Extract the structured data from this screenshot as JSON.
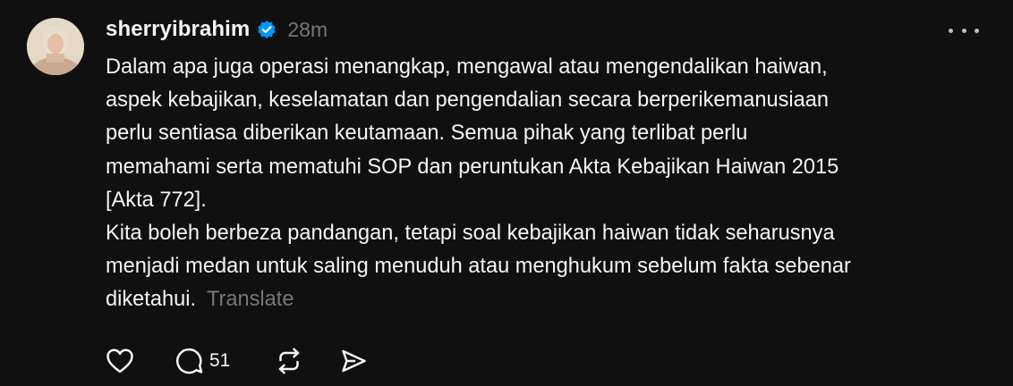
{
  "post": {
    "author": {
      "username": "sherryibrahim",
      "verified": true,
      "avatar_icon": "profile-photo"
    },
    "timestamp": "28m",
    "paragraphs": [
      "Dalam apa juga operasi menangkap, mengawal atau mengendalikan haiwan,\naspek kebajikan, keselamatan dan pengendalian secara berperikemanusiaan\nperlu sentiasa diberikan keutamaan. Semua pihak yang terlibat perlu\nmemahami serta mematuhi SOP dan peruntukan Akta Kebajikan Haiwan 2015\n[Akta 772].",
      "Kita boleh berbeza pandangan, tetapi soal kebajikan haiwan tidak seharusnya\nmenjadi medan untuk saling menuduh atau menghukum sebelum fakta sebenar\ndiketahui."
    ],
    "translate_label": "Translate",
    "actions": {
      "like_icon": "heart-icon",
      "comment_icon": "comment-icon",
      "comment_count": "51",
      "repost_icon": "repost-icon",
      "share_icon": "share-icon"
    }
  },
  "colors": {
    "background": "#101010",
    "text": "#f3f5f7",
    "muted": "#777777",
    "verified_badge": "#0095f6"
  }
}
